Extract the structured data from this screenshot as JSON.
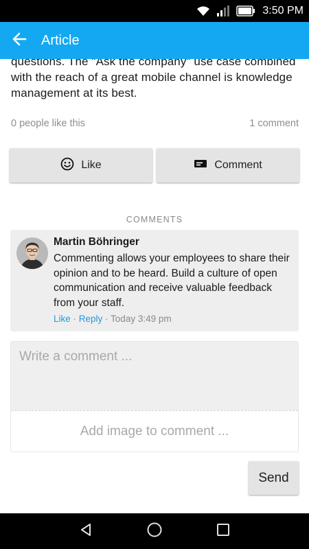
{
  "status_bar": {
    "time": "3:50 PM"
  },
  "app_bar": {
    "title": "Article"
  },
  "article": {
    "text": "questions. The \"Ask the company\" use case combined with the reach of a great mobile channel is knowledge management at its best.",
    "likes_text": "0 people like this",
    "comments_count_text": "1 comment"
  },
  "actions": {
    "like_label": "Like",
    "comment_label": "Comment"
  },
  "comments_section": {
    "label": "COMMENTS"
  },
  "comments": [
    {
      "author": "Martin Böhringer",
      "text": "Commenting allows your employees to share their opinion and to be heard. Build a culture of open communication and receive valuable feedback from your staff.",
      "like_label": "Like",
      "reply_label": "Reply",
      "separator": " · ",
      "timestamp": "Today 3:49 pm"
    }
  ],
  "compose": {
    "placeholder": "Write a comment ...",
    "add_image_label": "Add image to comment ...",
    "send_label": "Send"
  },
  "icons": {
    "status": [
      "wifi-icon",
      "signal-icon",
      "battery-icon"
    ],
    "app_bar": "arrow-back-icon",
    "like": "smiley-icon",
    "comment": "comment-icon",
    "nav": [
      "nav-back-icon",
      "nav-home-icon",
      "nav-recents-icon"
    ]
  },
  "colors": {
    "app_bar": "#14A8F2",
    "link": "#1E9BE0",
    "button_bg": "#E4E4E4",
    "card_bg": "#EEEEEE"
  }
}
